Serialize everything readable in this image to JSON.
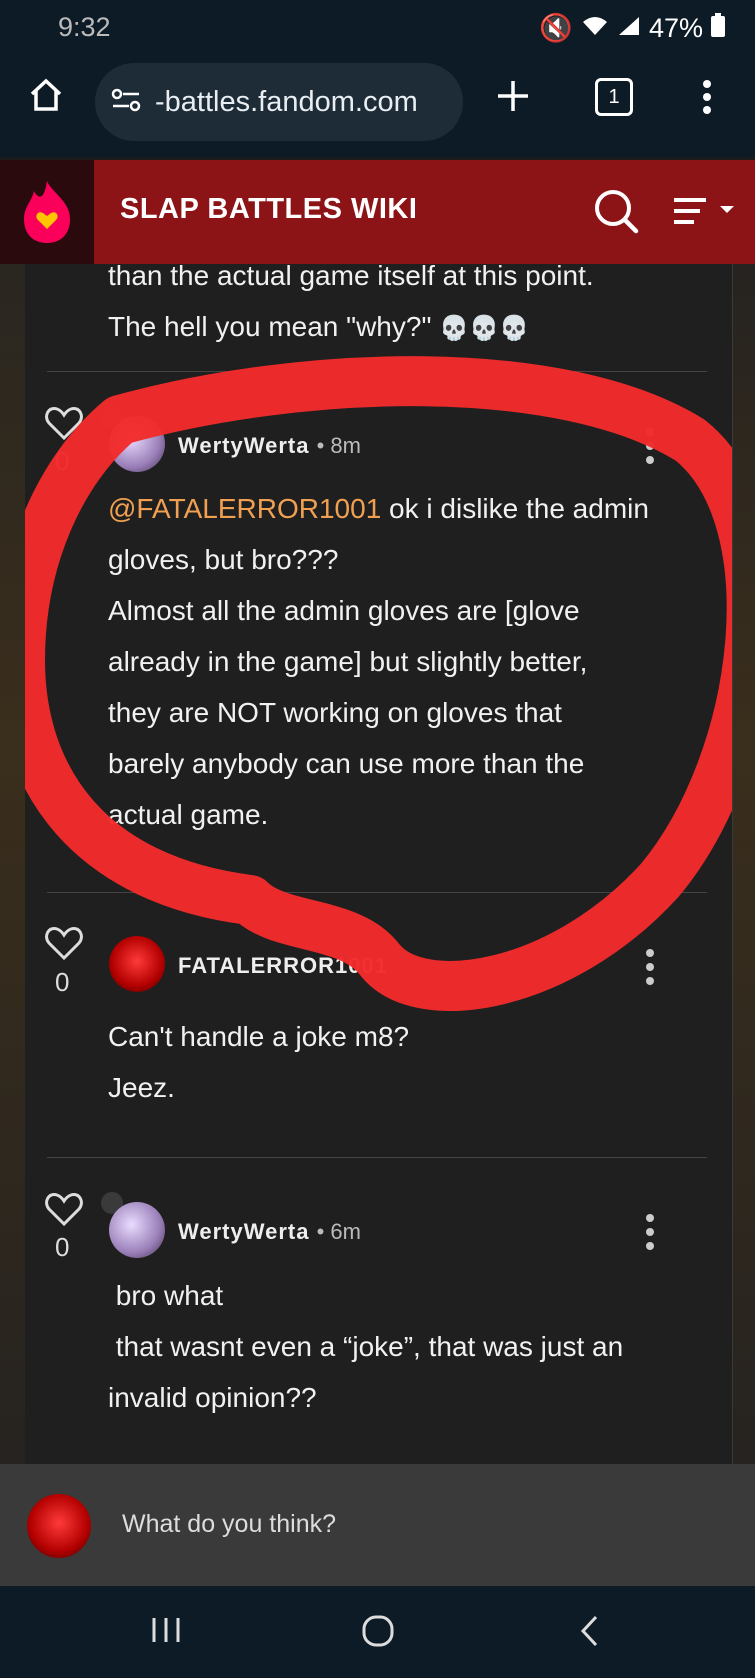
{
  "status": {
    "time": "9:32",
    "battery": "47%"
  },
  "browser": {
    "url": "-battles.fandom.com",
    "tab_count": "1"
  },
  "wiki": {
    "title": "SLAP BATTLES WIKI"
  },
  "prev_comment": {
    "lines": [
      "than the actual game itself at this point.",
      "The hell you mean \"why?\""
    ]
  },
  "comments": [
    {
      "likes": "0",
      "username": "WertyWerta",
      "time": "8m",
      "mention": "@FATALERROR1001",
      "lines": [
        " ok i dislike the admin",
        "gloves, but bro???",
        "Almost all the admin gloves are [glove",
        "already in the game] but slightly better,",
        "they are NOT working on gloves that",
        "barely anybody can use more than the",
        "actual game."
      ]
    },
    {
      "likes": "0",
      "username": "FATALERROR1001",
      "lines": [
        "Can't handle a joke m8?",
        "Jeez."
      ]
    },
    {
      "likes": "0",
      "username": "WertyWerta",
      "time": "6m",
      "lines": [
        " bro what",
        " that wasnt even a “joke”, that was just an",
        "invalid opinion??"
      ]
    }
  ],
  "reply": {
    "placeholder": "What do you think?"
  }
}
